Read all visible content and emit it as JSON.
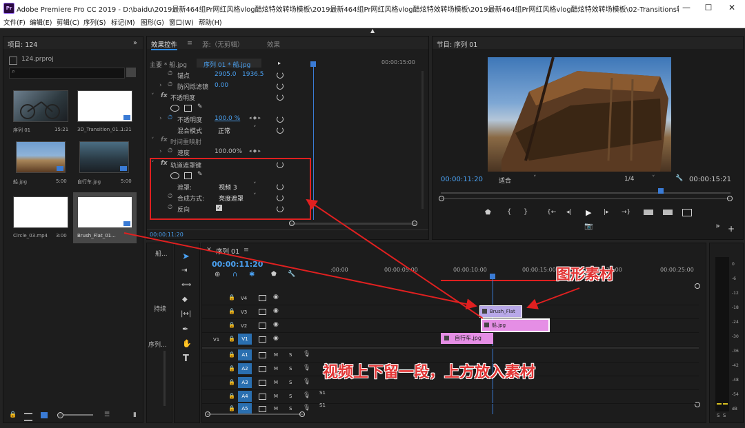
{
  "window": {
    "app_logo_text": "Pr",
    "title": "Adobe Premiere Pro CC 2019 - D:\\baidu\\2019最新464组Pr网红风格vlog酷炫特效转场模板\\2019最新464组Pr网红风格vlog酷炫特效转场模板\\2019最新464组Pr网红风格vlog酷炫特效转场模板\\02-Transitions转场特效模板...",
    "minimize": "—",
    "maximize": "☐",
    "close": "✕"
  },
  "menu": [
    "文件(F)",
    "编辑(E)",
    "剪辑(C)",
    "序列(S)",
    "标记(M)",
    "图形(G)",
    "窗口(W)",
    "帮助(H)"
  ],
  "project": {
    "title": "项目: 124",
    "file": "124.prproj",
    "items": [
      {
        "name": "序列 01",
        "duration": "15:21"
      },
      {
        "name": "3D_Transition_01...",
        "duration": "1:21"
      },
      {
        "name": "船.jpg",
        "duration": "5:00"
      },
      {
        "name": "自行车.jpg",
        "duration": "5:00"
      },
      {
        "name": "Circle_03.mp4",
        "duration": "3:00"
      },
      {
        "name": "Brush_Flat_01...",
        "duration": ""
      }
    ]
  },
  "effect_controls": {
    "tabs": [
      "效果控件",
      "源:（无剪辑）",
      "效果"
    ],
    "source_label": "主要 * 船.jpg",
    "sequence_label": "序列 01 * 船.jpg",
    "ruler_time": "00:00:15:00",
    "anchor": {
      "label": "锚点",
      "x": "2905.0",
      "y": "1936.5"
    },
    "antiflicker": {
      "label": "防闪烁滤镜",
      "value": "0.00"
    },
    "opacity": {
      "group": "不透明度",
      "label": "不透明度",
      "value": "100.0 %",
      "blend_label": "混合模式",
      "blend_value": "正常"
    },
    "time_remap": {
      "group": "时间重映射",
      "label": "速度",
      "value": "100.00%"
    },
    "track_matte": {
      "group": "轨道遮罩键",
      "matte_label": "遮罩:",
      "matte_value": "视频 3",
      "composite_label": "合成方式:",
      "composite_value": "亮度遮罩",
      "reverse_label": "反向"
    },
    "footer_time": "00:00:11:20"
  },
  "program": {
    "title": "节目: 序列 01",
    "timecode": "00:00:11:20",
    "fit": "适合",
    "resolution": "1/4",
    "duration": "00:00:15:21"
  },
  "timeline": {
    "title": "序列 01",
    "timecode": "00:00:11:20",
    "ruler": [
      ":00:00",
      "00:00:05:00",
      "00:00:10:00",
      "00:00:15:00",
      "00:00:20:00",
      "00:00:25:00"
    ],
    "left_labels": [
      "船...",
      "持续",
      "序列..."
    ],
    "v_tracks": [
      "V4",
      "V3",
      "V2",
      "V1"
    ],
    "a_tracks": [
      "A1",
      "A2",
      "A3",
      "A4",
      "A5"
    ],
    "source_v": "V1",
    "clips": {
      "brush": "Brush_Flat",
      "boat": "船.jpg",
      "bike": "自行车.jpg"
    },
    "mute": "M",
    "solo": "S",
    "s1": "S1",
    "s2": "S1",
    "meter_ticks": [
      "0",
      "-6",
      "-12",
      "-18",
      "-24",
      "-30",
      "-36",
      "-42",
      "-48",
      "-54",
      "dB"
    ],
    "meter_bottom": "S  S"
  },
  "annotations": {
    "graphic_material": "图形素材",
    "instruction": "视频上下留一段，上方放入素材"
  }
}
